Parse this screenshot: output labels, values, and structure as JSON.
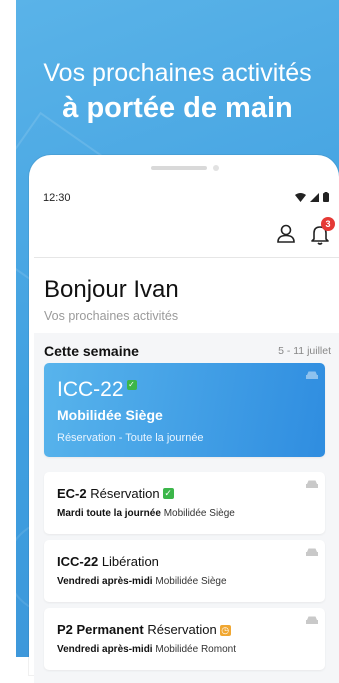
{
  "headline": {
    "line1": "Vos prochaines activités",
    "line2": "à portée de main"
  },
  "status": {
    "time": "12:30",
    "icons": "▾◢▮"
  },
  "notifications": {
    "count": "3"
  },
  "greeting": "Bonjour Ivan",
  "subtitle": "Vos prochaines activités",
  "week": {
    "title": "Cette semaine",
    "range": "5 - 11 juillet"
  },
  "featured": {
    "code": "ICC-22",
    "status_icon": "check-icon",
    "unit": "Mobilidée Siège",
    "detail": "Réservation - Toute la journée"
  },
  "activities": [
    {
      "code": "EC-2",
      "type": "Réservation",
      "status_icon": "check-icon",
      "when": "Mardi toute la journée",
      "unit": "Mobilidée Siège"
    },
    {
      "code": "ICC-22",
      "type": "Libération",
      "status_icon": "",
      "when": "Vendredi après-midi",
      "unit": "Mobilidée Siège"
    },
    {
      "code": "P2 Permanent",
      "type": "Réservation",
      "status_icon": "pending-icon",
      "when": "Vendredi après-midi",
      "unit": "Mobilidée Romont"
    }
  ],
  "colors": {
    "promo_bg": "#3f9fe0",
    "featured_card": "#2f8de0",
    "confirmed": "#3cb64a",
    "pending": "#f0a732",
    "badge": "#e53935"
  }
}
